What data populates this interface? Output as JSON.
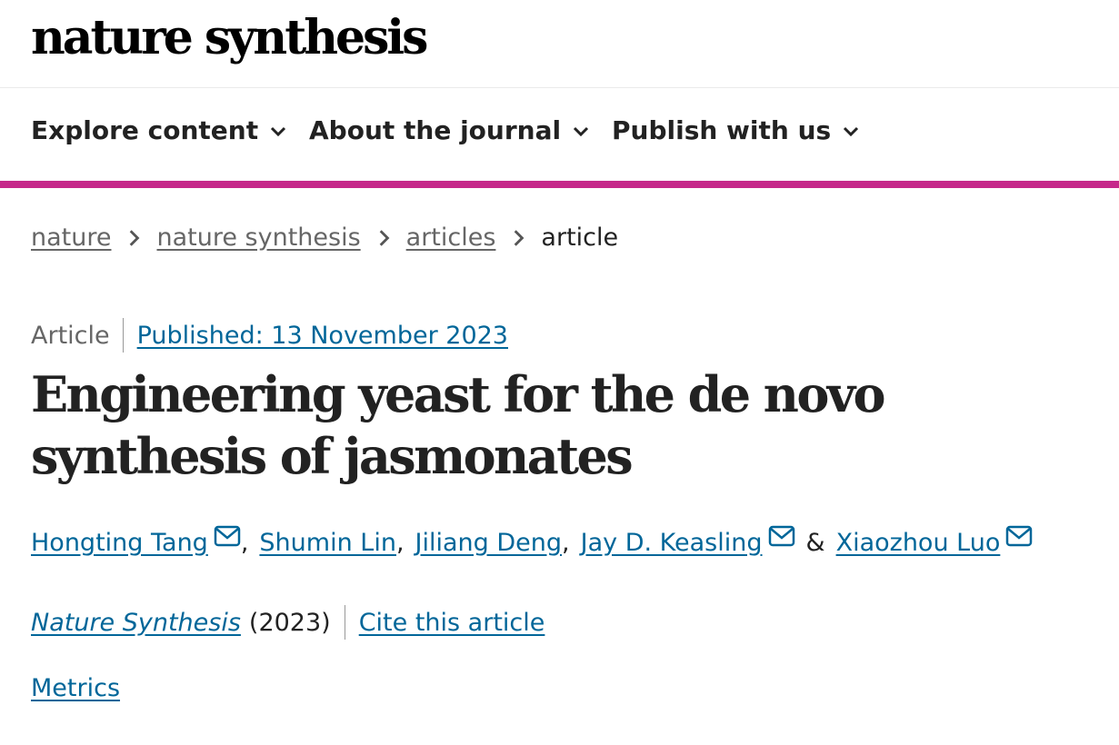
{
  "header": {
    "logo": "nature synthesis"
  },
  "nav": {
    "items": [
      {
        "label": "Explore content"
      },
      {
        "label": "About the journal"
      },
      {
        "label": "Publish with us"
      }
    ],
    "accent_color": "#c6288a"
  },
  "breadcrumb": {
    "items": [
      "nature",
      "nature synthesis",
      "articles"
    ],
    "current": "article"
  },
  "article": {
    "type": "Article",
    "published": "Published: 13 November 2023",
    "title": "Engineering yeast for the de novo synthesis of jasmonates",
    "authors": [
      {
        "name": "Hongting Tang",
        "email_icon": true,
        "sep": ","
      },
      {
        "name": "Shumin Lin",
        "email_icon": false,
        "sep": ","
      },
      {
        "name": "Jiliang Deng",
        "email_icon": false,
        "sep": ","
      },
      {
        "name": "Jay D. Keasling",
        "email_icon": true,
        "sep": "&"
      },
      {
        "name": "Xiaozhou Luo",
        "email_icon": true,
        "sep": ""
      }
    ],
    "journal": "Nature Synthesis",
    "year": "(2023)",
    "cite_label": "Cite this article",
    "metrics_label": "Metrics",
    "link_color": "#006699"
  }
}
